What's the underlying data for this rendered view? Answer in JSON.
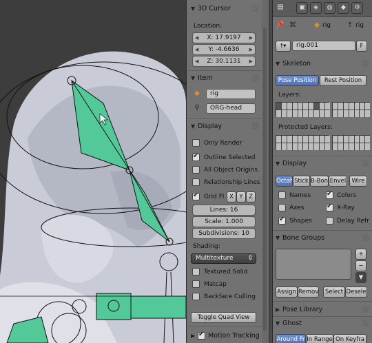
{
  "viewport": {
    "accent": "#53c99a",
    "background": "#3d3d3d"
  },
  "npanel": {
    "cursor_header": "3D Cursor",
    "location_label": "Location:",
    "loc_x": "X: 17.9197",
    "loc_y": "Y: -4.6636",
    "loc_z": "Z: 30.1131",
    "item_header": "Item",
    "item_object": "rig",
    "item_bone": "ORG-head",
    "display_header": "Display",
    "only_render": "Only Render",
    "outline_selected": "Outline Selected",
    "all_object_origins": "All Object Origins",
    "relationship_lines": "Relationship Lines",
    "grid_floor": "Grid Fl",
    "axis_x": "X",
    "axis_y": "Y",
    "axis_z": "Z",
    "lines": "Lines: 16",
    "scale": "Scale: 1.000",
    "subdivisions": "Subdivisions: 10",
    "shading_label": "Shading:",
    "shading_value": "Multitexture",
    "textured_solid": "Textured Solid",
    "matcap": "Matcap",
    "backface_culling": "Backface Culling",
    "toggle_quad": "Toggle Quad View",
    "motion_tracking": "Motion Tracking"
  },
  "props": {
    "breadcrumb_obj": "rig",
    "breadcrumb_bone": "rig",
    "data_name": "rig.001",
    "fake_user": "F",
    "skeleton_header": "Skeleton",
    "pose_position": "Pose Position",
    "rest_position": "Rest Position",
    "layers_label": "Layers:",
    "protected_label": "Protected Layers:",
    "display_header": "Display",
    "display_modes": [
      "Octah",
      "Stick",
      "B-Bon",
      "Envel",
      "Wire"
    ],
    "names": "Names",
    "colors": "Colors",
    "axes": "Axes",
    "xray": "X-Ray",
    "shapes": "Shapes",
    "delay_refresh": "Delay Refr",
    "bone_groups_header": "Bone Groups",
    "assign": "Assign",
    "remove": "Remov",
    "select": "Select",
    "deselect": "Desele",
    "pose_library_header": "Pose Library",
    "ghost_header": "Ghost",
    "ghost_modes": [
      "Around Fr",
      "In Range",
      "On Keyfra"
    ],
    "active_color": "#5a7fc6"
  }
}
